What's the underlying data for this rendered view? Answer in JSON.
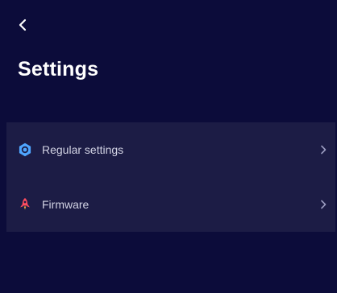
{
  "header": {
    "back_icon": "chevron-left-icon",
    "title": "Settings"
  },
  "settings": {
    "items": [
      {
        "label": "Regular settings",
        "icon": "gear-icon",
        "icon_color": "#4fa6ff"
      },
      {
        "label": "Firmware",
        "icon": "rocket-icon",
        "icon_color": "#ff4d5e"
      }
    ]
  },
  "colors": {
    "background": "#0c0c3a",
    "list_background": "#1c1c45",
    "text_primary": "#ffffff",
    "text_secondary": "#d2d3e4",
    "chevron": "#9a9bbf"
  }
}
